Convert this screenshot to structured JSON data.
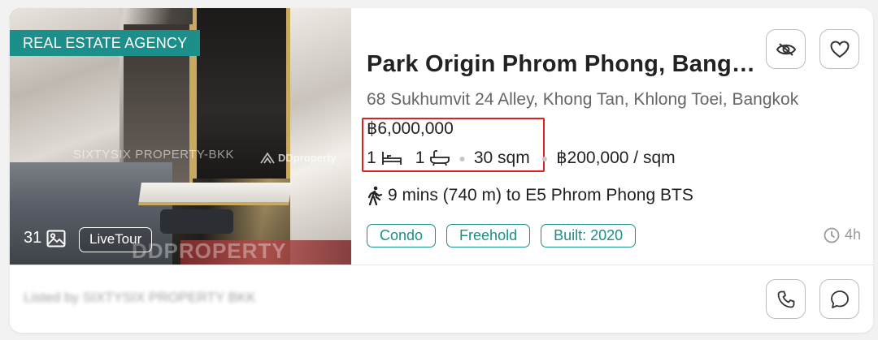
{
  "listing": {
    "agency_badge": "REAL ESTATE AGENCY",
    "photo_count": "31",
    "livetour_label": "LiveTour",
    "watermarks": {
      "agent": "SIXTYSIX PROPERTY-BKK",
      "brand": "DDproperty",
      "bottom": "DDPROPERTY"
    },
    "title": "Park Origin Phrom Phong, Bang…",
    "address": "68 Sukhumvit 24 Alley, Khong Tan, Khlong Toei, Bangkok",
    "price": "฿6,000,000",
    "bedrooms": "1",
    "bathrooms": "1",
    "area": "30 sqm",
    "price_per_sqm": "฿200,000 / sqm",
    "transit": "9 mins (740 m) to E5 Phrom Phong BTS",
    "tags": [
      "Condo",
      "Freehold",
      "Built: 2020"
    ],
    "posted_time": "4h",
    "listed_by": "Listed by SIXTYSIX PROPERTY BKK"
  },
  "icons": {
    "hide": "eye-slash-icon",
    "favorite": "heart-icon",
    "call": "phone-icon",
    "chat": "chat-bubble-icon",
    "photos": "image-icon",
    "bed": "bed-icon",
    "bath": "bathtub-icon",
    "walk": "walking-person-icon",
    "clock": "clock-icon"
  },
  "colors": {
    "accent": "#1c8f8a",
    "highlight": "#e02020",
    "muted": "#9a9a9a"
  }
}
